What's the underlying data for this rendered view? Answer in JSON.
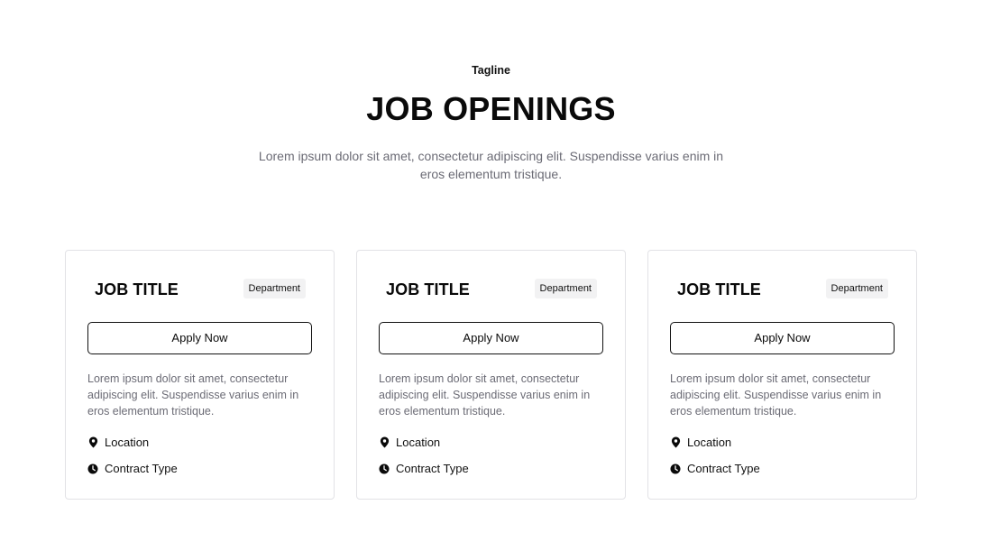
{
  "header": {
    "tagline": "Tagline",
    "title": "JOB OPENINGS",
    "subtitle": "Lorem ipsum dolor sit amet, consectetur adipiscing elit. Suspendisse varius enim in eros elementum tristique."
  },
  "jobs": [
    {
      "title": "JOB TITLE",
      "department": "Department",
      "apply_label": "Apply Now",
      "description": "Lorem ipsum dolor sit amet, consectetur adipiscing elit. Suspendisse varius enim in eros elementum tristique.",
      "location": "Location",
      "contract_type": "Contract Type",
      "location_icon": "map-pin-icon",
      "contract_icon": "clock-icon"
    },
    {
      "title": "JOB TITLE",
      "department": "Department",
      "apply_label": "Apply Now",
      "description": "Lorem ipsum dolor sit amet, consectetur adipiscing elit. Suspendisse varius enim in eros elementum tristique.",
      "location": "Location",
      "contract_type": "Contract Type",
      "location_icon": "map-pin-icon",
      "contract_icon": "clock-icon"
    },
    {
      "title": "JOB TITLE",
      "department": "Department",
      "apply_label": "Apply Now",
      "description": "Lorem ipsum dolor sit amet, consectetur adipiscing elit. Suspendisse varius enim in eros elementum tristique.",
      "location": "Location",
      "contract_type": "Contract Type",
      "location_icon": "map-pin-icon",
      "contract_icon": "clock-icon"
    }
  ],
  "colors": {
    "text": "#0a0a0a",
    "muted": "#6b6b75",
    "border": "#e2e2e6",
    "badge_bg": "#f2f2f3"
  }
}
